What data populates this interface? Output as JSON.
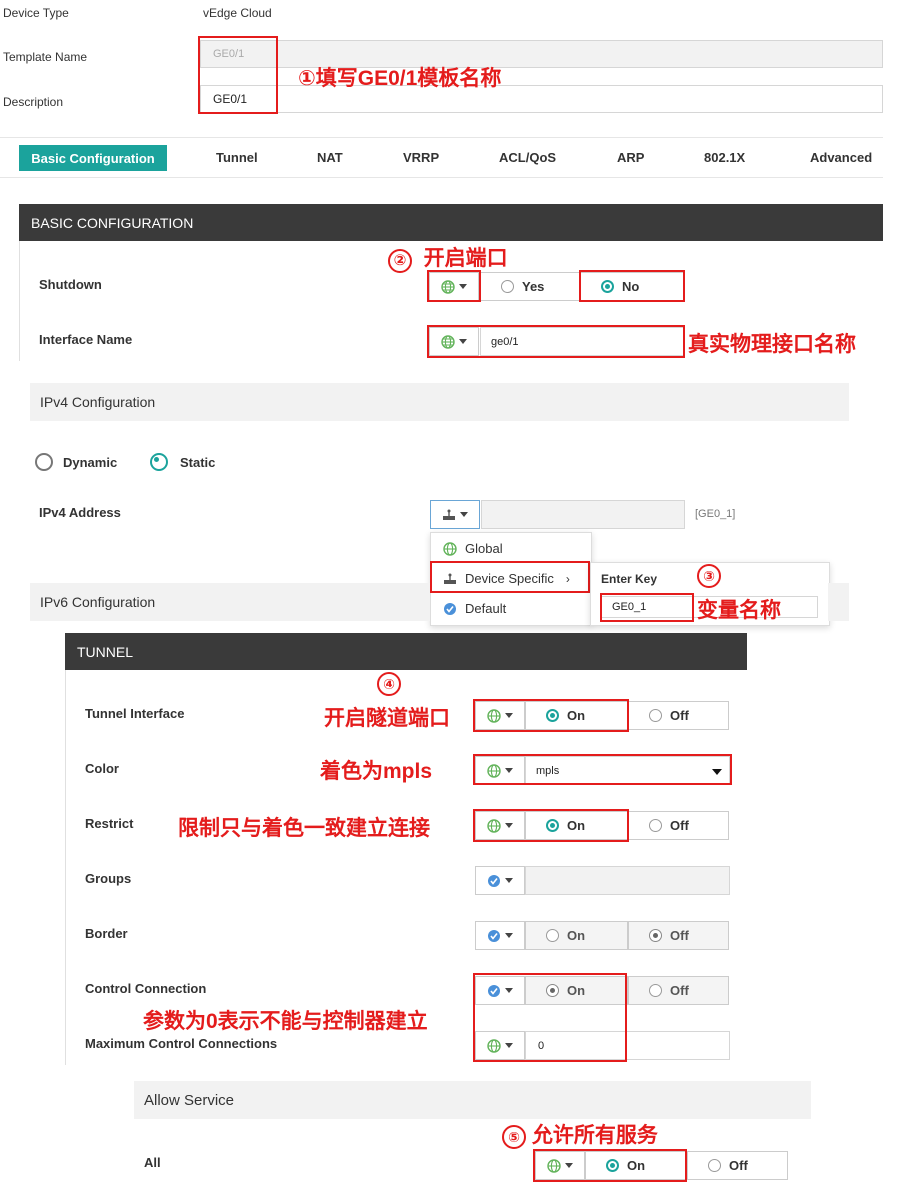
{
  "template": {
    "device_type_label": "Device Type",
    "device_type_value": "vEdge Cloud",
    "template_name_label": "Template Name",
    "template_name_value": "GE0/1",
    "description_label": "Description",
    "description_value": "GE0/1"
  },
  "tabs": [
    "Basic Configuration",
    "Tunnel",
    "NAT",
    "VRRP",
    "ACL/QoS",
    "ARP",
    "802.1X",
    "Advanced"
  ],
  "basic": {
    "header": "BASIC CONFIGURATION",
    "shutdown_label": "Shutdown",
    "yes_label": "Yes",
    "no_label": "No",
    "interface_name_label": "Interface Name",
    "interface_name_value": "ge0/1"
  },
  "ipv4": {
    "section_title": "IPv4 Configuration",
    "dynamic_label": "Dynamic",
    "static_label": "Static",
    "address_label": "IPv4 Address",
    "address_var": "[GE0_1]",
    "menu": [
      "Global",
      "Device Specific",
      "Default"
    ],
    "enter_key_label": "Enter Key",
    "enter_key_value": "GE0_1"
  },
  "ipv6": {
    "section_title": "IPv6 Configuration"
  },
  "tunnel": {
    "header": "TUNNEL",
    "interface_label": "Tunnel Interface",
    "color_label": "Color",
    "color_value": "mpls",
    "restrict_label": "Restrict",
    "groups_label": "Groups",
    "border_label": "Border",
    "control_conn_label": "Control Connection",
    "max_control_label": "Maximum Control Connections",
    "max_control_value": "0",
    "on": "On",
    "off": "Off"
  },
  "allow": {
    "section_title": "Allow Service",
    "all_label": "All",
    "on": "On",
    "off": "Off"
  },
  "annotations": {
    "a1": "①填写GE0/1模板名称",
    "a2_num": "②",
    "a2": "开启端口",
    "a_if": "真实物理接口名称",
    "a3_num": "③",
    "a3": "变量名称",
    "a4_num": "④",
    "a4": "开启隧道端口",
    "a_color": "着色为mpls",
    "a_restrict": "限制只与着色一致建立连接",
    "a_control": "参数为0表示不能与控制器建立",
    "a5_num": "⑤",
    "a5": "允许所有服务"
  },
  "colors": {
    "accent": "#1ba39c",
    "annotation": "#e41c1c",
    "header_bg": "#3a3a3a"
  }
}
